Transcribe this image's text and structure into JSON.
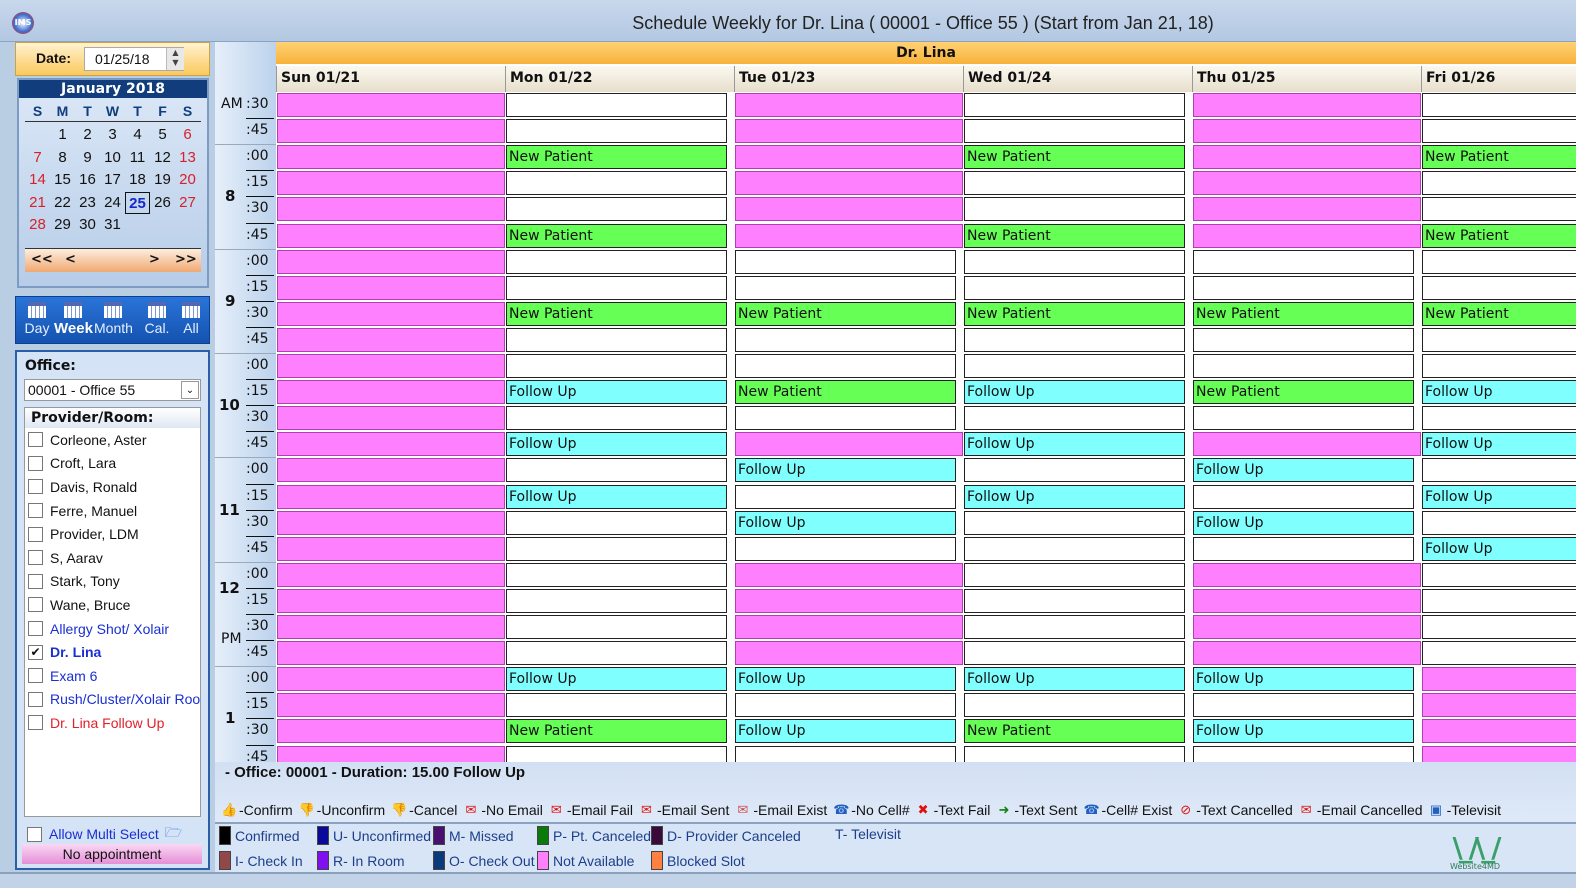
{
  "window": {
    "title": "Schedule Weekly for Dr. Lina ( 00001 - Office 55 )  (Start from Jan 21, 18)",
    "app_icon": "ims-app-icon"
  },
  "date": {
    "label": "Date:",
    "value": "01/25/18"
  },
  "calendar": {
    "title": "January 2018",
    "dow": [
      "S",
      "M",
      "T",
      "W",
      "T",
      "F",
      "S"
    ],
    "weeks": [
      [
        "",
        "1",
        "2",
        "3",
        "4",
        "5",
        "6"
      ],
      [
        "7",
        "8",
        "9",
        "10",
        "11",
        "12",
        "13"
      ],
      [
        "14",
        "15",
        "16",
        "17",
        "18",
        "19",
        "20"
      ],
      [
        "21",
        "22",
        "23",
        "24",
        "25",
        "26",
        "27"
      ],
      [
        "28",
        "29",
        "30",
        "31",
        "",
        "",
        ""
      ]
    ],
    "selected": "25",
    "nav": [
      "<<",
      "<",
      ">",
      ">>"
    ]
  },
  "views": [
    {
      "label": "Day",
      "icon": "day-view-icon"
    },
    {
      "label": "Week",
      "icon": "week-view-icon",
      "active": true
    },
    {
      "label": "Month",
      "icon": "month-view-icon"
    },
    {
      "label": "Cal.",
      "icon": "calendar-icon"
    },
    {
      "label": "All",
      "icon": "all-providers-icon"
    }
  ],
  "office": {
    "label": "Office:",
    "value": "00001 - Office 55"
  },
  "providers": {
    "label": "Provider/Room:",
    "items": [
      {
        "name": "Corleone, Aster",
        "checked": false,
        "color": "#111111"
      },
      {
        "name": "Croft, Lara",
        "checked": false,
        "color": "#111111"
      },
      {
        "name": "Davis, Ronald",
        "checked": false,
        "color": "#111111"
      },
      {
        "name": "Ferre, Manuel",
        "checked": false,
        "color": "#111111"
      },
      {
        "name": "Provider, LDM",
        "checked": false,
        "color": "#111111"
      },
      {
        "name": "S, Aarav",
        "checked": false,
        "color": "#111111"
      },
      {
        "name": "Stark, Tony",
        "checked": false,
        "color": "#111111"
      },
      {
        "name": "Wane, Bruce",
        "checked": false,
        "color": "#111111"
      },
      {
        "name": " Allergy Shot/ Xolair",
        "checked": false,
        "color": "#1a2fd1"
      },
      {
        "name": "Dr. Lina",
        "checked": true,
        "color": "#1a2fd1",
        "bold": true
      },
      {
        "name": "Exam 6",
        "checked": false,
        "color": "#1a2fd1"
      },
      {
        "name": "Rush/Cluster/Xolair  Room",
        "checked": false,
        "color": "#1a2fd1"
      },
      {
        "name": "Dr. Lina Follow Up",
        "checked": false,
        "color": "#e0202a"
      }
    ]
  },
  "allow_multi": {
    "label": "Allow Multi Select",
    "checked": false
  },
  "no_appointment": "No appointment",
  "schedule": {
    "provider": "Dr. Lina",
    "days": [
      "Sun 01/21",
      "Mon 01/22",
      "Tue 01/23",
      "Wed 01/24",
      "Thu 01/25",
      "Fri 01/26"
    ],
    "times": [
      {
        "ampm": "AM",
        "min": ":30"
      },
      {
        "min": ":45"
      },
      {
        "hour": "8",
        "min": ":00"
      },
      {
        "min": ":15"
      },
      {
        "min": ":30"
      },
      {
        "min": ":45"
      },
      {
        "hour": "9",
        "min": ":00"
      },
      {
        "min": ":15"
      },
      {
        "min": ":30"
      },
      {
        "min": ":45"
      },
      {
        "hour": "10",
        "min": ":00"
      },
      {
        "min": ":15"
      },
      {
        "min": ":30"
      },
      {
        "min": ":45"
      },
      {
        "hour": "11",
        "min": ":00"
      },
      {
        "min": ":15"
      },
      {
        "min": ":30"
      },
      {
        "min": ":45"
      },
      {
        "hour": "12",
        "min": ":00"
      },
      {
        "min": ":15"
      },
      {
        "ampm": "PM",
        "min": ":30"
      },
      {
        "min": ":45"
      },
      {
        "hour": "1",
        "min": ":00"
      },
      {
        "min": ":15"
      },
      {
        "min": ":30"
      },
      {
        "min": ":45"
      }
    ],
    "slot_types": {
      "na": {
        "label": "",
        "color": "#ff80ff"
      },
      "open": {
        "label": "",
        "color": "#ffffff"
      },
      "new": {
        "label": "New Patient",
        "color": "#66ff55"
      },
      "fu": {
        "label": "Follow Up",
        "color": "#80ffff"
      }
    },
    "slots": [
      [
        "na",
        "na",
        "na",
        "na",
        "na",
        "na",
        "na",
        "na",
        "na",
        "na",
        "na",
        "na",
        "na",
        "na",
        "na",
        "na",
        "na",
        "na",
        "na",
        "na",
        "na",
        "na",
        "na",
        "na",
        "na",
        "na"
      ],
      [
        "open",
        "open",
        "new",
        "open",
        "open",
        "new",
        "open",
        "open",
        "new",
        "open",
        "open",
        "fu",
        "open",
        "fu",
        "open",
        "fu",
        "open",
        "open",
        "open",
        "open",
        "open",
        "open",
        "fu",
        "open",
        "new",
        "open"
      ],
      [
        "na",
        "na",
        "na",
        "na",
        "na",
        "na",
        "open",
        "open",
        "new",
        "open",
        "open",
        "new",
        "open",
        "na",
        "fu",
        "open",
        "fu",
        "open",
        "na",
        "na",
        "na",
        "na",
        "fu",
        "open",
        "fu",
        "open"
      ],
      [
        "open",
        "open",
        "new",
        "open",
        "open",
        "new",
        "open",
        "open",
        "new",
        "open",
        "open",
        "fu",
        "open",
        "fu",
        "open",
        "fu",
        "open",
        "open",
        "open",
        "open",
        "open",
        "open",
        "fu",
        "open",
        "new",
        "open"
      ],
      [
        "na",
        "na",
        "na",
        "na",
        "na",
        "na",
        "open",
        "open",
        "new",
        "open",
        "open",
        "new",
        "open",
        "na",
        "fu",
        "open",
        "fu",
        "open",
        "na",
        "na",
        "na",
        "na",
        "fu",
        "open",
        "fu",
        "open"
      ],
      [
        "open",
        "open",
        "new",
        "open",
        "open",
        "new",
        "open",
        "open",
        "new",
        "open",
        "open",
        "fu",
        "open",
        "fu",
        "open",
        "fu",
        "open",
        "fu",
        "open",
        "open",
        "open",
        "open",
        "na",
        "na",
        "na",
        "na"
      ]
    ]
  },
  "info": "- Office: 00001   - Duration: 15.00  Follow Up",
  "icon_legend": [
    {
      "icon": "thumbs-up-icon",
      "glyph": "👍",
      "color": "#2a9a2a",
      "label": "-Confirm"
    },
    {
      "icon": "thumbs-down-icon",
      "glyph": "👎",
      "color": "#f0a800",
      "label": "-Unconfirm"
    },
    {
      "icon": "cancel-thumb-icon",
      "glyph": "👎",
      "color": "#e01010",
      "label": "-Cancel"
    },
    {
      "icon": "no-email-icon",
      "glyph": "✉",
      "color": "#e01010",
      "label": "-No Email"
    },
    {
      "icon": "email-fail-icon",
      "glyph": "✉",
      "color": "#e01010",
      "label": "-Email Fail"
    },
    {
      "icon": "email-sent-icon",
      "glyph": "✉",
      "color": "#e01010",
      "label": "-Email Sent"
    },
    {
      "icon": "email-exist-icon",
      "glyph": "✉",
      "color": "#d05050",
      "label": "-Email Exist"
    },
    {
      "icon": "no-cell-icon",
      "glyph": "☎",
      "color": "#2060c0",
      "label": "-No Cell#"
    },
    {
      "icon": "text-fail-icon",
      "glyph": "✖",
      "color": "#e01010",
      "label": "-Text Fail"
    },
    {
      "icon": "text-sent-icon",
      "glyph": "➜",
      "color": "#108010",
      "label": "-Text Sent"
    },
    {
      "icon": "cell-exist-icon",
      "glyph": "☎",
      "color": "#2060c0",
      "label": "-Cell# Exist"
    },
    {
      "icon": "text-cancelled-icon",
      "glyph": "⊘",
      "color": "#e01010",
      "label": "-Text Cancelled"
    },
    {
      "icon": "email-cancelled-icon",
      "glyph": "✉",
      "color": "#e01010",
      "label": "-Email Cancelled"
    },
    {
      "icon": "televisit-icon",
      "glyph": "▣",
      "color": "#2060c0",
      "label": "-Televisit"
    }
  ],
  "status_legend": [
    {
      "label": "Confirmed",
      "color": "#000000"
    },
    {
      "label": "U- Unconfirmed",
      "color": "#0a0a9a"
    },
    {
      "label": "M- Missed",
      "color": "#4a1070"
    },
    {
      "label": "P- Pt. Canceled",
      "color": "#0a7a0a"
    },
    {
      "label": "D- Provider Canceled",
      "color": "#3a0a3a"
    },
    {
      "label": "T- Televisit",
      "color": ""
    },
    {
      "label": "I- Check In",
      "color": "#904848"
    },
    {
      "label": "R- In Room",
      "color": "#8010f0"
    },
    {
      "label": "O- Check Out",
      "color": "#0a3a7a"
    },
    {
      "label": "Not Available",
      "color": "#ff80ff"
    },
    {
      "label": "Blocked Slot",
      "color": "#ff8040"
    }
  ],
  "logo": {
    "text": "Website4MD"
  }
}
